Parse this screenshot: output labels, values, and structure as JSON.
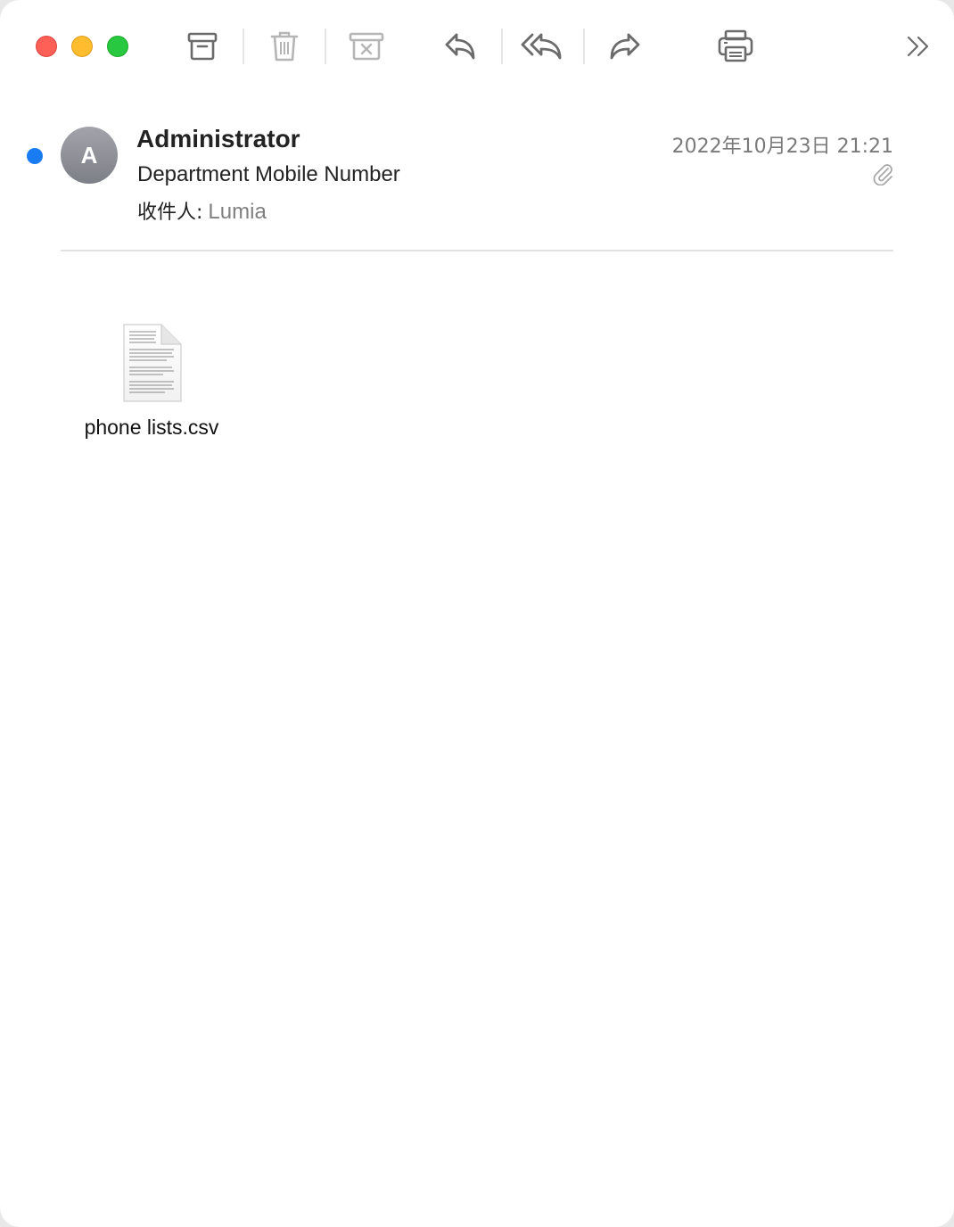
{
  "window": {
    "controls": [
      "close",
      "minimize",
      "zoom"
    ]
  },
  "toolbar": {
    "buttons": [
      {
        "name": "archive",
        "icon": "archive-box-icon",
        "enabled": true
      },
      {
        "name": "delete",
        "icon": "trash-icon",
        "enabled": false
      },
      {
        "name": "junk",
        "icon": "junk-box-icon",
        "enabled": false
      },
      {
        "name": "reply",
        "icon": "reply-arrow-icon",
        "enabled": true
      },
      {
        "name": "reply-all",
        "icon": "reply-all-arrow-icon",
        "enabled": true
      },
      {
        "name": "forward",
        "icon": "forward-arrow-icon",
        "enabled": true
      },
      {
        "name": "print",
        "icon": "printer-icon",
        "enabled": true
      },
      {
        "name": "more",
        "icon": "chevron-double-right-icon",
        "enabled": true
      }
    ]
  },
  "message": {
    "unread": true,
    "avatar_initial": "A",
    "sender": "Administrator",
    "subject": "Department Mobile Number",
    "to_label": "收件人:",
    "to_value": "Lumia",
    "date": "2022年10月23日 21:21",
    "has_attachment": true
  },
  "attachment": {
    "icon": "text-document-icon",
    "file_name": "phone lists.csv"
  },
  "colors": {
    "unread_dot": "#1a7cf5",
    "close": "#fe5f57",
    "minimize": "#febc2e",
    "zoom": "#28c840",
    "icon_enabled": "#6b6b6b",
    "icon_disabled": "#b5b5b5"
  }
}
